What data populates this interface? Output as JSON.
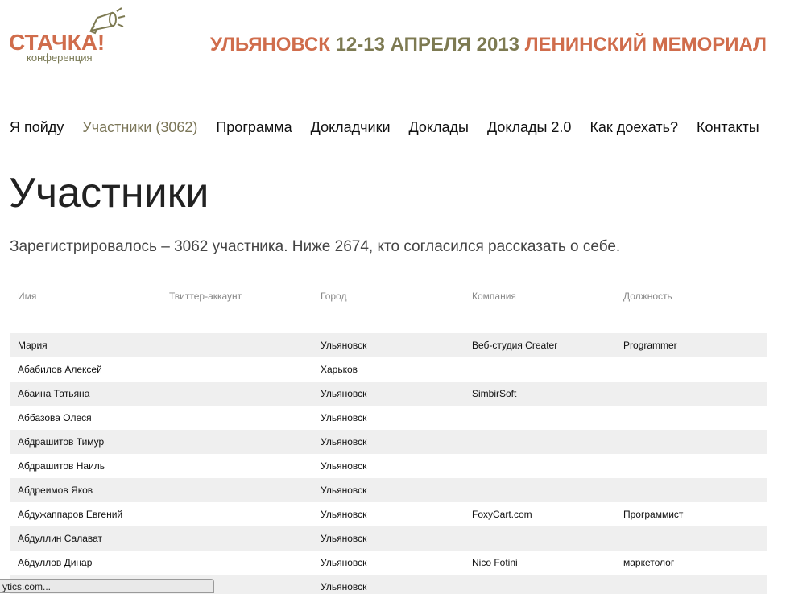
{
  "header": {
    "logo_text": "СТАЧКА!",
    "logo_sub": "конференция",
    "banner_city": "УЛЬЯНОВСК",
    "banner_dates": "12-13 АПРЕЛЯ 2013",
    "banner_venue": "ЛЕНИНСКИЙ МЕМОРИАЛ"
  },
  "nav": {
    "items": [
      {
        "label": "Я пойду"
      },
      {
        "label": "Участники (3062)"
      },
      {
        "label": "Программа"
      },
      {
        "label": "Докладчики"
      },
      {
        "label": "Доклады"
      },
      {
        "label": "Доклады 2.0"
      },
      {
        "label": "Как доехать?"
      },
      {
        "label": "Контакты"
      }
    ]
  },
  "page": {
    "title": "Участники",
    "summary": "Зарегистрировалось – 3062 участника. Ниже 2674, кто согласился рассказать о себе."
  },
  "table": {
    "headers": [
      "Имя",
      "Твиттер-аккаунт",
      "Город",
      "Компания",
      "Должность"
    ],
    "rows": [
      [
        "Мария",
        "",
        "Ульяновск",
        "Веб-студия Creater",
        "Programmer"
      ],
      [
        "Абабилов Алексей",
        "",
        "Харьков",
        "",
        ""
      ],
      [
        "Абаина Татьяна",
        "",
        "Ульяновск",
        "SimbirSoft",
        ""
      ],
      [
        "Аббазова Олеся",
        "",
        "Ульяновск",
        "",
        ""
      ],
      [
        "Абдрашитов Тимур",
        "",
        "Ульяновск",
        "",
        ""
      ],
      [
        "Абдрашитов Наиль",
        "",
        "Ульяновск",
        "",
        ""
      ],
      [
        "Абдреимов Яков",
        "",
        "Ульяновск",
        "",
        ""
      ],
      [
        "Абдужаппаров Евгений",
        "",
        "Ульяновск",
        "FoxyCart.com",
        "Программист"
      ],
      [
        "Абдуллин Салават",
        "",
        "Ульяновск",
        "",
        ""
      ],
      [
        "Абдуллов Динар",
        "",
        "Ульяновск",
        "Nico Fotini",
        "маркетолог"
      ],
      [
        "",
        "",
        "Ульяновск",
        "",
        ""
      ]
    ]
  },
  "statusbar": {
    "text": "ytics.com..."
  },
  "colors": {
    "accent_orange": "#d06d4c",
    "accent_olive": "#7d7a52",
    "row_stripe": "#efefef"
  }
}
